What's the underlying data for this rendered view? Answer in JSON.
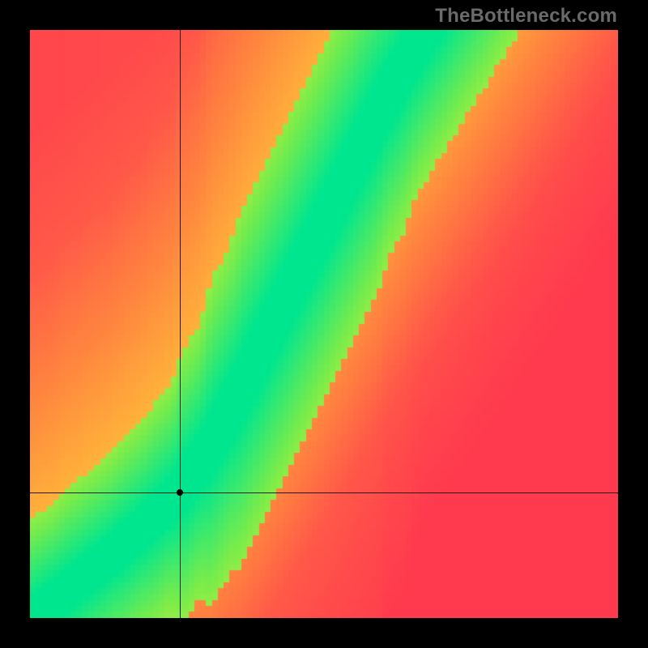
{
  "watermark": "TheBottleneck.com",
  "chart_data": {
    "type": "heatmap",
    "title": "",
    "xlabel": "",
    "ylabel": "",
    "xlim": [
      0,
      1
    ],
    "ylim": [
      0,
      1
    ],
    "grid": false,
    "legend": false,
    "crosshair": {
      "x": 0.255,
      "y": 0.213
    },
    "dot": {
      "x": 0.255,
      "y": 0.213
    },
    "optimal_curve": {
      "description": "Green diagonal ridge; ideal y vs x (normalized 0..1)",
      "points": [
        {
          "x": 0.0,
          "y": 0.0
        },
        {
          "x": 0.05,
          "y": 0.035
        },
        {
          "x": 0.1,
          "y": 0.075
        },
        {
          "x": 0.15,
          "y": 0.115
        },
        {
          "x": 0.2,
          "y": 0.16
        },
        {
          "x": 0.25,
          "y": 0.21
        },
        {
          "x": 0.3,
          "y": 0.28
        },
        {
          "x": 0.35,
          "y": 0.37
        },
        {
          "x": 0.4,
          "y": 0.47
        },
        {
          "x": 0.45,
          "y": 0.57
        },
        {
          "x": 0.5,
          "y": 0.67
        },
        {
          "x": 0.55,
          "y": 0.77
        },
        {
          "x": 0.6,
          "y": 0.87
        },
        {
          "x": 0.65,
          "y": 0.96
        },
        {
          "x": 0.675,
          "y": 1.0
        }
      ]
    },
    "ridge_width_norm": 0.055,
    "colorscale": {
      "description": "distance from ridge → color",
      "stops": [
        {
          "t": 0.0,
          "color": "#00e68f"
        },
        {
          "t": 0.1,
          "color": "#7aec4a"
        },
        {
          "t": 0.2,
          "color": "#e3f03a"
        },
        {
          "t": 0.32,
          "color": "#ffe63a"
        },
        {
          "t": 0.48,
          "color": "#ffb63a"
        },
        {
          "t": 0.65,
          "color": "#ff843f"
        },
        {
          "t": 0.82,
          "color": "#ff5a48"
        },
        {
          "t": 1.0,
          "color": "#ff3a4e"
        }
      ]
    },
    "pixelation": 100
  }
}
